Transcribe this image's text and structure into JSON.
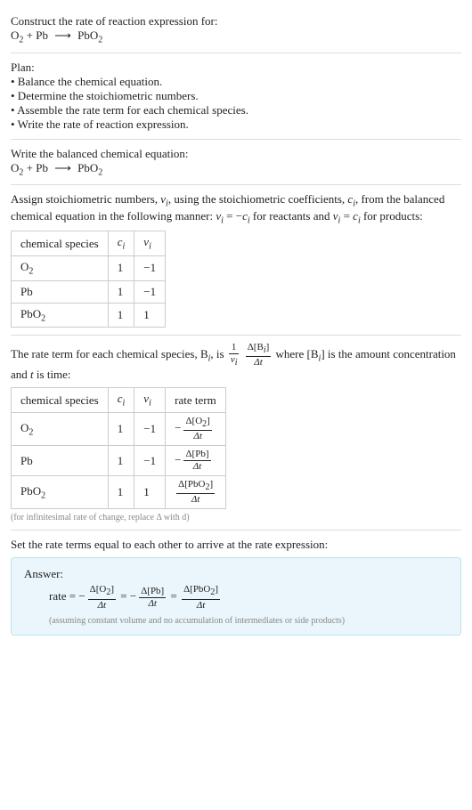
{
  "s1": {
    "title": "Construct the rate of reaction expression for:",
    "eq_l1": "O",
    "eq_l1s": "2",
    "eq_plus": " + Pb ",
    "eq_arrow": "⟶",
    "eq_r1": " PbO",
    "eq_r1s": "2"
  },
  "s2": {
    "title": "Plan:",
    "b1": "• Balance the chemical equation.",
    "b2": "• Determine the stoichiometric numbers.",
    "b3": "• Assemble the rate term for each chemical species.",
    "b4": "• Write the rate of reaction expression."
  },
  "s3": {
    "title": "Write the balanced chemical equation:",
    "eq_l1": "O",
    "eq_l1s": "2",
    "eq_plus": " + Pb ",
    "eq_arrow": "⟶",
    "eq_r1": " PbO",
    "eq_r1s": "2"
  },
  "s4": {
    "p_a": "Assign stoichiometric numbers, ",
    "nu_i": "ν",
    "nu_is": "i",
    "p_b": ", using the stoichiometric coefficients, ",
    "c_i": "c",
    "c_is": "i",
    "p_c": ", from the balanced chemical equation in the following manner: ",
    "eq1_l": "ν",
    "eq1_ls": "i",
    "eq1_eq": " = −",
    "eq1_r": "c",
    "eq1_rs": "i",
    "p_d": " for reactants and ",
    "eq2_l": "ν",
    "eq2_ls": "i",
    "eq2_eq": " = ",
    "eq2_r": "c",
    "eq2_rs": "i",
    "p_e": " for products:",
    "tbl": {
      "h1": "chemical species",
      "h2": "c",
      "h2s": "i",
      "h3": "ν",
      "h3s": "i",
      "r1c1a": "O",
      "r1c1b": "2",
      "r1c2": "1",
      "r1c3": "−1",
      "r2c1": "Pb",
      "r2c2": "1",
      "r2c3": "−1",
      "r3c1a": "PbO",
      "r3c1b": "2",
      "r3c2": "1",
      "r3c3": "1"
    }
  },
  "s5": {
    "p_a": "The rate term for each chemical species, B",
    "p_as": "i",
    "p_b": ", is ",
    "f1_num": "1",
    "f1_den_a": "ν",
    "f1_den_b": "i",
    "f2_num_a": "Δ[B",
    "f2_num_b": "i",
    "f2_num_c": "]",
    "f2_den": "Δt",
    "p_c": " where [B",
    "p_cs": "i",
    "p_d": "] is the amount concentration and ",
    "t": "t",
    "p_e": " is time:",
    "tbl": {
      "h1": "chemical species",
      "h2": "c",
      "h2s": "i",
      "h3": "ν",
      "h3s": "i",
      "h4": "rate term",
      "r1c1a": "O",
      "r1c1b": "2",
      "r1c2": "1",
      "r1c3": "−1",
      "r1c4_neg": "−",
      "r1c4_num_a": "Δ[O",
      "r1c4_num_b": "2",
      "r1c4_num_c": "]",
      "r1c4_den": "Δt",
      "r2c1": "Pb",
      "r2c2": "1",
      "r2c3": "−1",
      "r2c4_neg": "−",
      "r2c4_num": "Δ[Pb]",
      "r2c4_den": "Δt",
      "r3c1a": "PbO",
      "r3c1b": "2",
      "r3c2": "1",
      "r3c3": "1",
      "r3c4_num_a": "Δ[PbO",
      "r3c4_num_b": "2",
      "r3c4_num_c": "]",
      "r3c4_den": "Δt"
    },
    "caption": "(for infinitesimal rate of change, replace Δ with d)"
  },
  "s6": {
    "title": "Set the rate terms equal to each other to arrive at the rate expression:"
  },
  "ans": {
    "title": "Answer:",
    "rate": "rate = ",
    "t1_neg": "−",
    "t1_num_a": "Δ[O",
    "t1_num_b": "2",
    "t1_num_c": "]",
    "t1_den": "Δt",
    "eq1": " = ",
    "t2_neg": "−",
    "t2_num": "Δ[Pb]",
    "t2_den": "Δt",
    "eq2": " = ",
    "t3_num_a": "Δ[PbO",
    "t3_num_b": "2",
    "t3_num_c": "]",
    "t3_den": "Δt",
    "note": "(assuming constant volume and no accumulation of intermediates or side products)"
  },
  "chart_data": {
    "type": "table",
    "tables": [
      {
        "title": "Stoichiometric numbers",
        "columns": [
          "chemical species",
          "c_i",
          "ν_i"
        ],
        "rows": [
          [
            "O2",
            1,
            -1
          ],
          [
            "Pb",
            1,
            -1
          ],
          [
            "PbO2",
            1,
            1
          ]
        ]
      },
      {
        "title": "Rate terms",
        "columns": [
          "chemical species",
          "c_i",
          "ν_i",
          "rate term"
        ],
        "rows": [
          [
            "O2",
            1,
            -1,
            "-Δ[O2]/Δt"
          ],
          [
            "Pb",
            1,
            -1,
            "-Δ[Pb]/Δt"
          ],
          [
            "PbO2",
            1,
            1,
            "Δ[PbO2]/Δt"
          ]
        ]
      }
    ]
  }
}
